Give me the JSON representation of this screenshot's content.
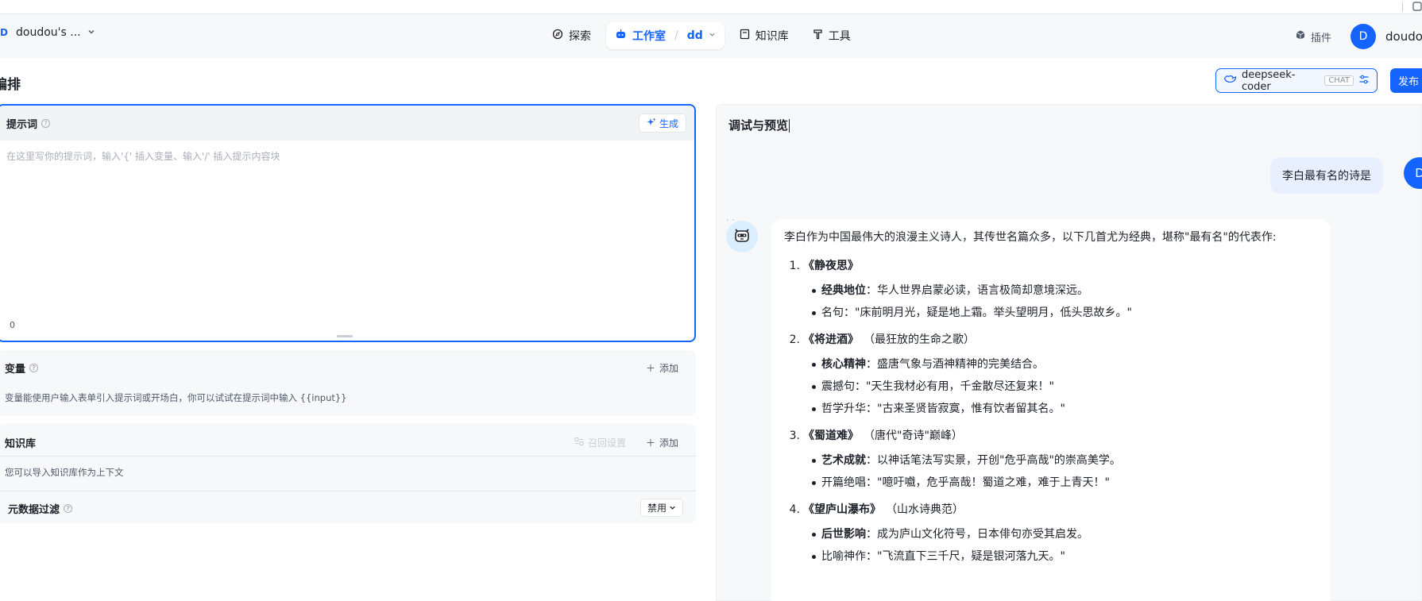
{
  "top_strip": {
    "right_text": "插件"
  },
  "workspace": {
    "badge": "D",
    "name": "doudou's ..."
  },
  "nav": {
    "explore": "探索",
    "studio": "工作室",
    "studio_sub": "dd",
    "knowledge": "知识库",
    "tools": "工具"
  },
  "header_right": {
    "plugin": "插件",
    "avatar_letter": "D",
    "user_name": "doudou"
  },
  "section_title": "编排",
  "model": {
    "name": "deepseek-coder",
    "tag": "CHAT"
  },
  "publish_label": "发布",
  "prompt": {
    "label": "提示词",
    "help": "?",
    "generate_label": "生成",
    "placeholder": "在这里写你的提示词，输入'{' 插入变量、输入'/' 插入提示内容块",
    "count": "0"
  },
  "variables": {
    "label": "变量",
    "add_label": "添加",
    "description": "变量能使用户输入表单引入提示词或开场白，你可以试试在提示词中输入 {{input}}"
  },
  "knowledge": {
    "label": "知识库",
    "recall_label": "召回设置",
    "add_label": "添加",
    "description": "您可以导入知识库作为上下文"
  },
  "metadata_filter": {
    "label": "元数据过滤",
    "select_value": "禁用"
  },
  "preview": {
    "title": "调试与预览",
    "user_message": "李白最有名的诗是",
    "user_avatar_letter": "D",
    "bot_dots": "· ·",
    "answer": {
      "intro": "李白作为中国最伟大的浪漫主义诗人，其传世名篇众多，以下几首尤为经典，堪称\"最有名\"的代表作:",
      "poems": [
        {
          "num": "1.",
          "title": "《静夜思》",
          "note": "",
          "bullets": [
            {
              "key": "经典地位",
              "text": "：华人世界启蒙必读，语言极简却意境深远。"
            },
            {
              "key": "",
              "text": "名句：\"床前明月光，疑是地上霜。举头望明月，低头思故乡。\""
            }
          ]
        },
        {
          "num": "2.",
          "title": "《将进酒》",
          "note": "（最狂放的生命之歌）",
          "bullets": [
            {
              "key": "核心精神",
              "text": "：盛唐气象与酒神精神的完美结合。"
            },
            {
              "key": "",
              "text": "震撼句：\"天生我材必有用，千金散尽还复来！\""
            },
            {
              "key": "",
              "text": "哲学升华：\"古来圣贤皆寂寞，惟有饮者留其名。\""
            }
          ]
        },
        {
          "num": "3.",
          "title": "《蜀道难》",
          "note": "（唐代\"奇诗\"巅峰）",
          "bullets": [
            {
              "key": "艺术成就",
              "text": "：以神话笔法写实景，开创\"危乎高哉\"的崇高美学。"
            },
            {
              "key": "",
              "text": "开篇绝唱：\"噫吁嚱，危乎高哉！蜀道之难，难于上青天！\""
            }
          ]
        },
        {
          "num": "4.",
          "title": "《望庐山瀑布》",
          "note": "（山水诗典范）",
          "bullets": [
            {
              "key": "后世影响",
              "text": "：成为庐山文化符号，日本俳句亦受其启发。"
            },
            {
              "key": "",
              "text": "比喻神作：\"飞流直下三千尺，疑是银河落九天。\""
            }
          ]
        }
      ]
    }
  },
  "colors": {
    "accent": "#1664ff",
    "panel_bg": "#f7f8fa",
    "bubble_bg": "#e8f0ff"
  }
}
